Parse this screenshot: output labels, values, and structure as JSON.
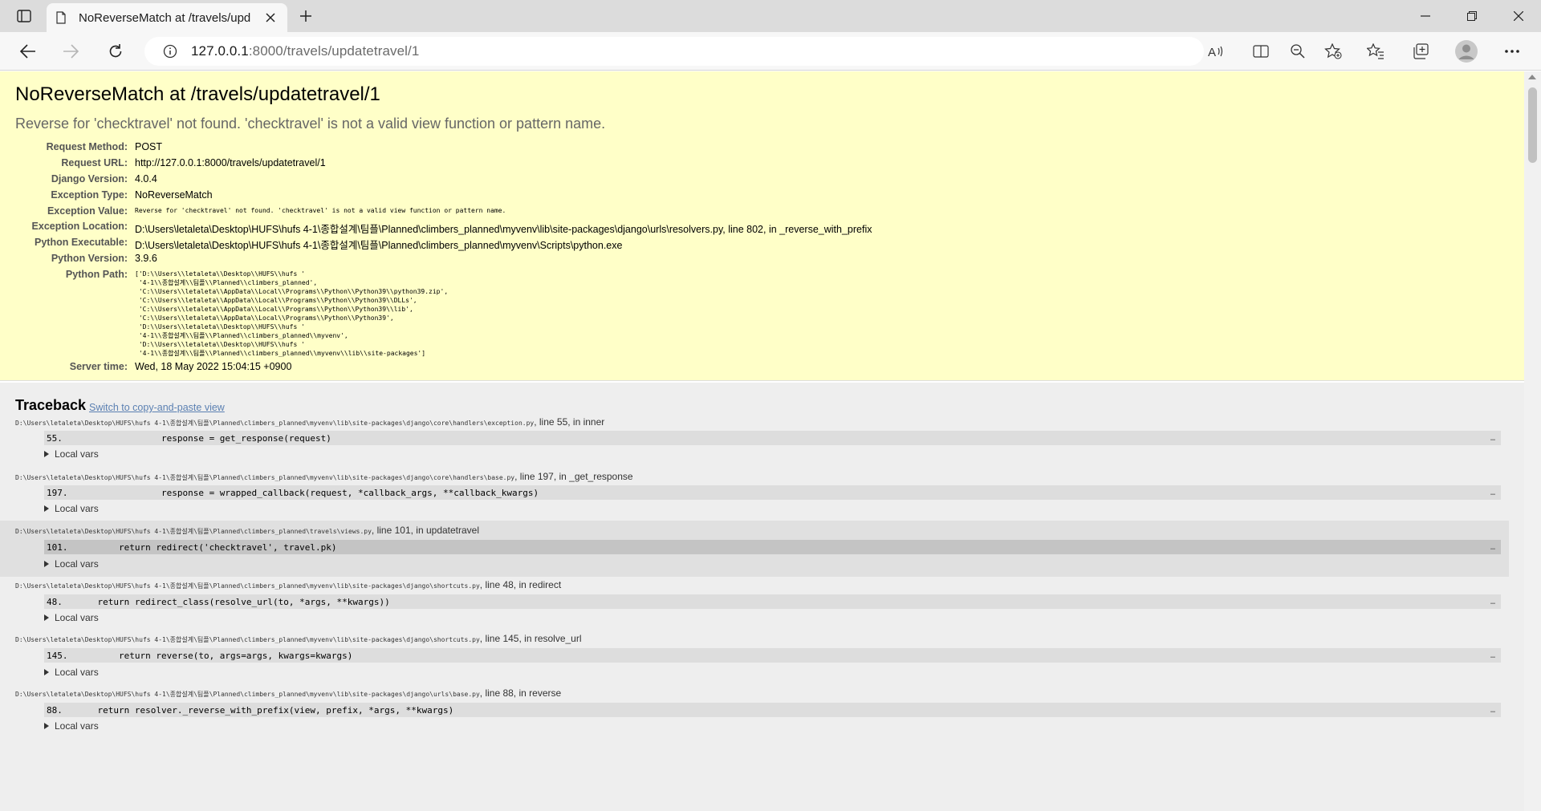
{
  "browser": {
    "tab_title": "NoReverseMatch at /travels/upd",
    "url_host": "127.0.0.1",
    "url_rest": ":8000/travels/updatetravel/1"
  },
  "error": {
    "title": "NoReverseMatch at /travels/updatetravel/1",
    "explanation": "Reverse for 'checktravel' not found. 'checktravel' is not a valid view function or pattern name."
  },
  "meta": [
    {
      "key": "Request Method:",
      "value": "POST"
    },
    {
      "key": "Request URL:",
      "value": "http://127.0.0.1:8000/travels/updatetravel/1"
    },
    {
      "key": "Django Version:",
      "value": "4.0.4"
    },
    {
      "key": "Exception Type:",
      "value": "NoReverseMatch"
    },
    {
      "key": "Exception Value:",
      "value": "Reverse for 'checktravel' not found. 'checktravel' is not a valid view function or pattern name."
    },
    {
      "key": "Exception Location:",
      "value": "D:\\Users\\letaleta\\Desktop\\HUFS\\hufs 4-1\\종합설계\\팀플\\Planned\\climbers_planned\\myvenv\\lib\\site-packages\\django\\urls\\resolvers.py, line 802, in _reverse_with_prefix"
    },
    {
      "key": "Python Executable:",
      "value": "D:\\Users\\letaleta\\Desktop\\HUFS\\hufs 4-1\\종합설계\\팀플\\Planned\\climbers_planned\\myvenv\\Scripts\\python.exe"
    },
    {
      "key": "Python Version:",
      "value": "3.9.6"
    },
    {
      "key": "Python Path:",
      "value": "['D:\\\\Users\\\\letaleta\\\\Desktop\\\\HUFS\\\\hufs '\n '4-1\\\\종합설계\\\\팀플\\\\Planned\\\\climbers_planned',\n 'C:\\\\Users\\\\letaleta\\\\AppData\\\\Local\\\\Programs\\\\Python\\\\Python39\\\\python39.zip',\n 'C:\\\\Users\\\\letaleta\\\\AppData\\\\Local\\\\Programs\\\\Python\\\\Python39\\\\DLLs',\n 'C:\\\\Users\\\\letaleta\\\\AppData\\\\Local\\\\Programs\\\\Python\\\\Python39\\\\lib',\n 'C:\\\\Users\\\\letaleta\\\\AppData\\\\Local\\\\Programs\\\\Python\\\\Python39',\n 'D:\\\\Users\\\\letaleta\\\\Desktop\\\\HUFS\\\\hufs '\n '4-1\\\\종합설계\\\\팀플\\\\Planned\\\\climbers_planned\\\\myvenv',\n 'D:\\\\Users\\\\letaleta\\\\Desktop\\\\HUFS\\\\hufs '\n '4-1\\\\종합설계\\\\팀플\\\\Planned\\\\climbers_planned\\\\myvenv\\\\lib\\\\site-packages']"
    },
    {
      "key": "Server time:",
      "value": "Wed, 18 May 2022 15:04:15 +0900"
    }
  ],
  "traceback": {
    "heading": "Traceback",
    "switch_link": "Switch to copy-and-paste view",
    "local_vars_label": "Local vars",
    "frames": [
      {
        "path": "D:\\Users\\letaleta\\Desktop\\HUFS\\hufs 4-1\\종합설계\\팀플\\Planned\\climbers_planned\\myvenv\\lib\\site-packages\\django\\core\\handlers\\exception.py",
        "location": ", line 55, in inner",
        "lineno": "55.",
        "code": "                response = get_response(request)"
      },
      {
        "path": "D:\\Users\\letaleta\\Desktop\\HUFS\\hufs 4-1\\종합설계\\팀플\\Planned\\climbers_planned\\myvenv\\lib\\site-packages\\django\\core\\handlers\\base.py",
        "location": ", line 197, in _get_response",
        "lineno": "197.",
        "code": "                response = wrapped_callback(request, *callback_args, **callback_kwargs)"
      },
      {
        "path": "D:\\Users\\letaleta\\Desktop\\HUFS\\hufs 4-1\\종합설계\\팀플\\Planned\\climbers_planned\\travels\\views.py",
        "location": ", line 101, in updatetravel",
        "lineno": "101.",
        "code": "        return redirect('checktravel', travel.pk)"
      },
      {
        "path": "D:\\Users\\letaleta\\Desktop\\HUFS\\hufs 4-1\\종합설계\\팀플\\Planned\\climbers_planned\\myvenv\\lib\\site-packages\\django\\shortcuts.py",
        "location": ", line 48, in redirect",
        "lineno": "48.",
        "code": "    return redirect_class(resolve_url(to, *args, **kwargs))"
      },
      {
        "path": "D:\\Users\\letaleta\\Desktop\\HUFS\\hufs 4-1\\종합설계\\팀플\\Planned\\climbers_planned\\myvenv\\lib\\site-packages\\django\\shortcuts.py",
        "location": ", line 145, in resolve_url",
        "lineno": "145.",
        "code": "        return reverse(to, args=args, kwargs=kwargs)"
      },
      {
        "path": "D:\\Users\\letaleta\\Desktop\\HUFS\\hufs 4-1\\종합설계\\팀플\\Planned\\climbers_planned\\myvenv\\lib\\site-packages\\django\\urls\\base.py",
        "location": ", line 88, in reverse",
        "lineno": "88.",
        "code": "    return resolver._reverse_with_prefix(view, prefix, *args, **kwargs)"
      }
    ]
  }
}
